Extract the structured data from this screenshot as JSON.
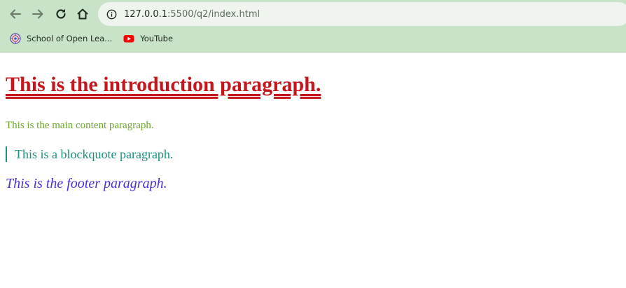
{
  "browser": {
    "url_host": "127.0.0.1",
    "url_path": ":5500/q2/index.html",
    "bookmarks": [
      {
        "label": "School of Open Lea...",
        "icon": "school-logo-icon"
      },
      {
        "label": "YouTube",
        "icon": "youtube-icon"
      }
    ]
  },
  "content": {
    "intro": "This is the introduction paragraph.",
    "main": "This is the main content paragraph.",
    "blockquote": "This is a blockquote paragraph.",
    "footer": "This is the footer paragraph."
  },
  "colors": {
    "chrome_background": "#c8e3c7",
    "intro_text": "#c4161c",
    "main_text": "#6aa52c",
    "blockquote_text": "#1b8f7d",
    "footer_text": "#4a2fd8"
  }
}
